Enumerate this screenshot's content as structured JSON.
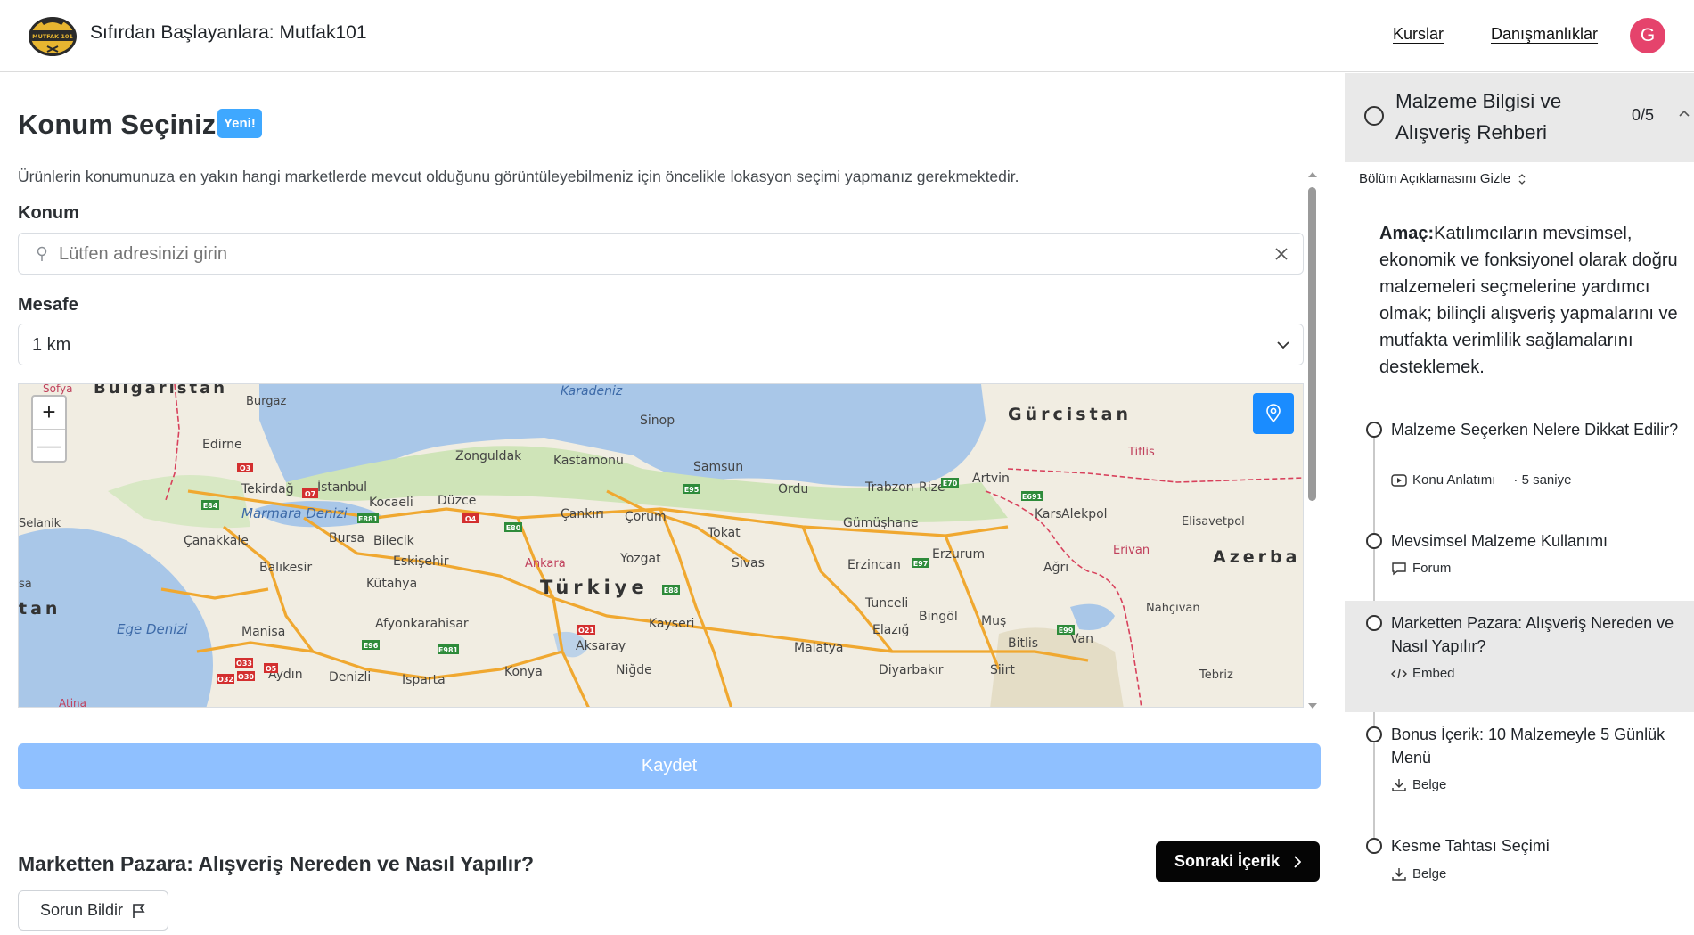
{
  "header": {
    "logo_text": "MUTFAK 101",
    "title": "Sıfırdan Başlayanlara: Mutfak101",
    "nav": [
      {
        "label": "Kurslar"
      },
      {
        "label": "Danışmanlıklar"
      }
    ],
    "avatar_initial": "G"
  },
  "main": {
    "title": "Konum Seçiniz",
    "badge": "Yeni!",
    "description": "Ürünlerin konumunuza en yakın hangi marketlerde mevcut olduğunu görüntüleyebilmeniz için öncelikle lokasyon seçimi yapmanız gerekmektedir.",
    "location_label": "Konum",
    "location_placeholder": "Lütfen adresinizi girin",
    "location_value": "",
    "distance_label": "Mesafe",
    "distance_value": "1 km",
    "map": {
      "zoom_in": "+",
      "zoom_out": "—",
      "labels": {
        "bulgaristan": "Bulgaristan",
        "sofya": "Sofya",
        "burgaz": "Burgaz",
        "karadeniz": "Karadeniz",
        "sinop": "Sinop",
        "gurcistan": "Gürcistan",
        "edirne": "Edirne",
        "zonguldak": "Zonguldak",
        "kastamonu": "Kastamonu",
        "samsun": "Samsun",
        "ordu": "Ordu",
        "trabzon": "Trabzon",
        "rize": "Rize",
        "artvin": "Artvin",
        "tiflis": "Tiflis",
        "tekirdag": "Tekirdağ",
        "istanbul": "İstanbul",
        "kocaeli": "Kocaeli",
        "duzce": "Düzce",
        "marmara": "Marmara Denizi",
        "cankiri": "Çankırı",
        "corum": "Çorum",
        "tokat": "Tokat",
        "gumushane": "Gümüşhane",
        "kars": "Kars",
        "alekpol": "Alekpol",
        "elisavetpol": "Elisavetpol",
        "selanik": "Selanik",
        "canakkale": "Çanakkale",
        "bursa": "Bursa",
        "bilecik": "Bilecik",
        "eskisehir": "Eskişehir",
        "ankara": "Ankara",
        "yozgat": "Yozgat",
        "sivas": "Sivas",
        "erzincan": "Erzincan",
        "erzurum": "Erzurum",
        "agri": "Ağrı",
        "erivan": "Erivan",
        "azerba": "Azerba",
        "balikesir": "Balıkesir",
        "kutahya": "Kütahya",
        "turkiye": "Türkiye",
        "tunceli": "Tunceli",
        "bingol": "Bingöl",
        "mus": "Muş",
        "nahcivan": "Nahçıvan",
        "tan": "tan",
        "sa": "sa",
        "ege": "Ege Denizi",
        "manisa": "Manisa",
        "afyonkarahisar": "Afyonkarahisar",
        "aksaray": "Aksaray",
        "kayseri": "Kayseri",
        "elazig": "Elazığ",
        "malatya": "Malatya",
        "bitlis": "Bitlis",
        "van": "Van",
        "aydin": "Aydın",
        "denizli": "Denizli",
        "isparta": "Isparta",
        "konya": "Konya",
        "nigde": "Niğde",
        "diyarbakir": "Diyarbakır",
        "siirt": "Siirt",
        "tebriz": "Tebriz",
        "atina": "Atina"
      },
      "shields": [
        "O3",
        "O7",
        "E84",
        "E881",
        "O4",
        "E80",
        "E95",
        "E70",
        "E691",
        "O21",
        "E88",
        "E97",
        "E96",
        "E99",
        "O33",
        "O5",
        "O32",
        "O30",
        "E981"
      ]
    },
    "save_label": "Kaydet",
    "content_title": "Marketten Pazara: Alışveriş Nereden ve Nasıl Yapılır?",
    "next_label": "Sonraki İçerik",
    "report_label": "Sorun Bildir"
  },
  "sidebar": {
    "section_title": "Malzeme Bilgisi ve Alışveriş Rehberi",
    "section_progress": "0/5",
    "toggle_label": "Bölüm Açıklamasını Gizle",
    "goal_label": "Amaç:",
    "goal_text": "Katılımcıların mevsimsel, ekonomik ve fonksiyonel olarak doğru malzemeleri seçmelerine yardımcı olmak; bilinçli alışveriş yapmalarını ve mutfakta verimlilik sağlamalarını desteklemek.",
    "lessons": [
      {
        "title": "Malzeme Seçerken Nelere Dikkat Edilir?",
        "type": "Konu Anlatımı",
        "duration": "· 5 saniye"
      },
      {
        "title": "Mevsimsel Malzeme Kullanımı",
        "type": "Forum"
      },
      {
        "title": "Marketten Pazara: Alışveriş Nereden ve Nasıl Yapılır?",
        "type": "Embed"
      },
      {
        "title": "Bonus İçerik: 10 Malzemeyle 5 Günlük Menü",
        "type": "Belge"
      },
      {
        "title": "Kesme Tahtası Seçimi",
        "type": "Belge"
      }
    ]
  }
}
